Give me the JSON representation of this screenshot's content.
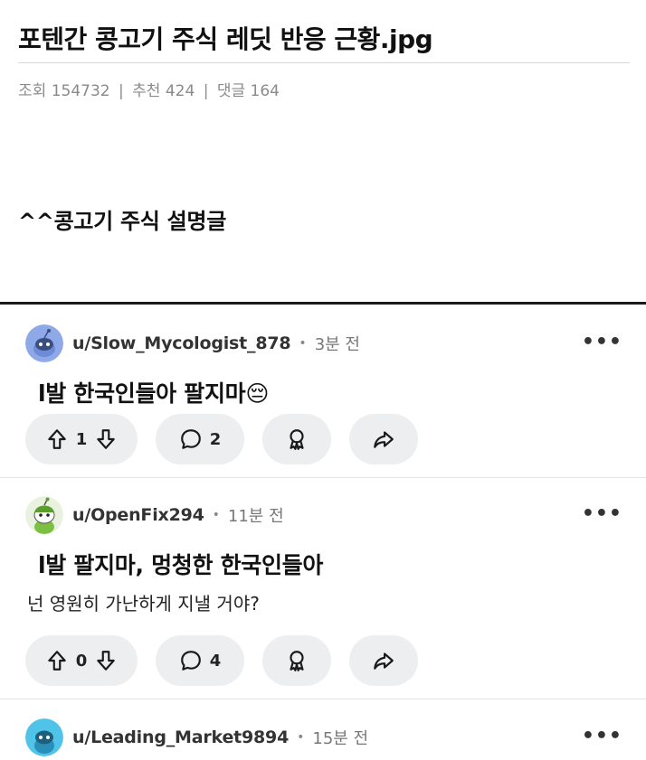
{
  "post": {
    "title": "포텐간 콩고기 주식 레딧 반응 근황.jpg",
    "views_label": "조회",
    "views": "154732",
    "recommend_label": "추천",
    "recommend": "424",
    "comments_label": "댓글",
    "comments": "164",
    "separator": "|"
  },
  "caption": "^^콩고기 주식 설명글",
  "comments": [
    {
      "username": "u/Slow_Mycologist_878",
      "time": "3분 전",
      "text": "l발 한국인들아 팔지마😔",
      "subtext": "",
      "votes": "1",
      "replies": "2",
      "avatar_color": "#8fa9e8"
    },
    {
      "username": "u/OpenFix294",
      "time": "11분 전",
      "text": "l발 팔지마, 멍청한 한국인들아",
      "subtext": "넌 영원히 가난하게 지낼 거야?",
      "votes": "0",
      "replies": "4",
      "avatar_color": "#e8f2de"
    },
    {
      "username": "u/Leading_Market9894",
      "time": "15분 전",
      "text": "",
      "subtext": "",
      "votes": "",
      "replies": "",
      "avatar_color": "#4fc3e8"
    }
  ],
  "ui": {
    "dot": "•",
    "more": "•••"
  },
  "icons": {
    "upvote": "arrow-up-icon",
    "downvote": "arrow-down-icon",
    "reply": "speech-bubble-icon",
    "award": "award-icon",
    "share": "share-arrow-icon",
    "more": "more-dots-icon"
  }
}
